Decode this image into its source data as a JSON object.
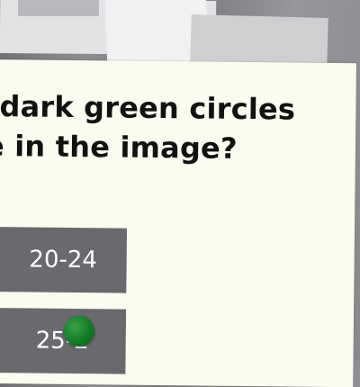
{
  "question": {
    "line1": "dark green circles",
    "line2": "e in the image?"
  },
  "answers": [
    {
      "label": "20-24"
    },
    {
      "label": "25-2"
    }
  ],
  "pointer": {
    "color": "#137a25"
  }
}
